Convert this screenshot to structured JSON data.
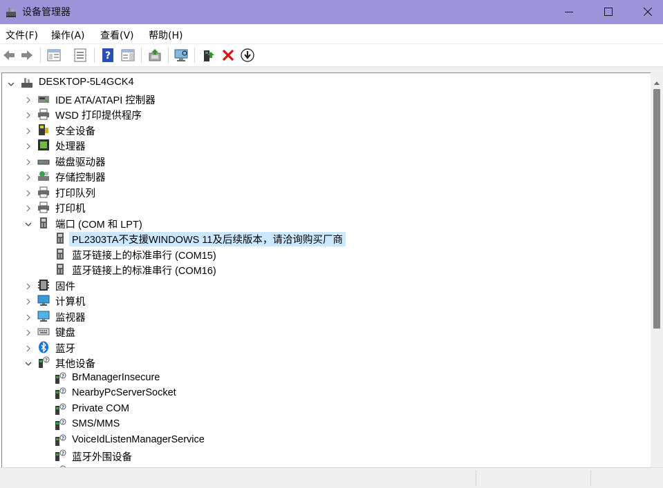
{
  "window": {
    "title": "设备管理器"
  },
  "menu": [
    {
      "label": "文件(F)"
    },
    {
      "label": "操作(A)"
    },
    {
      "label": "查看(V)"
    },
    {
      "label": "帮助(H)"
    }
  ],
  "toolbar": {
    "buttons": [
      "back-arrow-icon",
      "forward-arrow-icon",
      "show-hide-console-tree-icon",
      "properties-icon",
      "help-icon",
      "action-pane-icon",
      "update-driver-icon",
      "scan-hardware-icon",
      "enable-device-icon",
      "uninstall-device-icon",
      "download-driver-icon"
    ]
  },
  "tree": {
    "root": "DESKTOP-5L4GCK4",
    "items": [
      {
        "label": "IDE ATA/ATAPI 控制器",
        "expanded": false,
        "icon": "ide-controller-icon"
      },
      {
        "label": "WSD 打印提供程序",
        "expanded": false,
        "icon": "printer-icon"
      },
      {
        "label": "安全设备",
        "expanded": false,
        "icon": "security-device-icon"
      },
      {
        "label": "处理器",
        "expanded": false,
        "icon": "processor-icon"
      },
      {
        "label": "磁盘驱动器",
        "expanded": false,
        "icon": "disk-drive-icon"
      },
      {
        "label": "存储控制器",
        "expanded": false,
        "icon": "storage-controller-icon"
      },
      {
        "label": "打印队列",
        "expanded": false,
        "icon": "print-queue-icon"
      },
      {
        "label": "打印机",
        "expanded": false,
        "icon": "printer-icon"
      },
      {
        "label": "端口 (COM 和 LPT)",
        "expanded": true,
        "icon": "port-icon",
        "children": [
          {
            "label": "PL2303TA不支援WINDOWS 11及后续版本，请洽询购买厂商",
            "selected": true,
            "icon": "port-icon"
          },
          {
            "label": "蓝牙链接上的标准串行 (COM15)",
            "icon": "port-icon"
          },
          {
            "label": "蓝牙链接上的标准串行 (COM16)",
            "icon": "port-icon"
          }
        ]
      },
      {
        "label": "固件",
        "expanded": false,
        "icon": "firmware-icon"
      },
      {
        "label": "计算机",
        "expanded": false,
        "icon": "computer-icon"
      },
      {
        "label": "监视器",
        "expanded": false,
        "icon": "monitor-icon"
      },
      {
        "label": "键盘",
        "expanded": false,
        "icon": "keyboard-icon"
      },
      {
        "label": "蓝牙",
        "expanded": false,
        "icon": "bluetooth-icon"
      },
      {
        "label": "其他设备",
        "expanded": true,
        "icon": "unknown-device-icon",
        "children": [
          {
            "label": "BrManagerInsecure",
            "icon": "unknown-device-icon"
          },
          {
            "label": "NearbyPcServerSocket",
            "icon": "unknown-device-icon"
          },
          {
            "label": "Private COM",
            "icon": "unknown-device-icon"
          },
          {
            "label": "SMS/MMS",
            "icon": "unknown-device-icon"
          },
          {
            "label": "VoiceIdListenManagerService",
            "icon": "unknown-device-icon"
          },
          {
            "label": "蓝牙外围设备",
            "icon": "unknown-device-icon"
          }
        ]
      }
    ]
  },
  "colors": {
    "titlebar": "#9b94d9",
    "selection": "#cce8ff",
    "bluetooth": "#1a73d9"
  }
}
